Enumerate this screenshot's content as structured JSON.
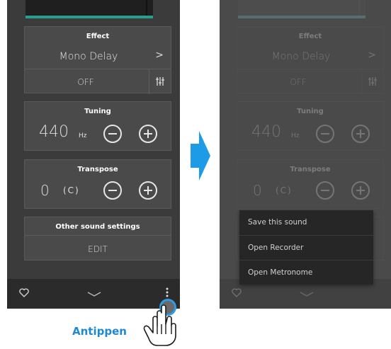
{
  "left_screen": {
    "effect": {
      "title": "Effect",
      "value": "Mono Delay",
      "chevron": ">",
      "state": "OFF"
    },
    "tuning": {
      "title": "Tuning",
      "value": "440",
      "unit": "Hz"
    },
    "transpose": {
      "title": "Transpose",
      "value": "0",
      "key": "(C)"
    },
    "other": {
      "title": "Other sound settings",
      "action": "EDIT"
    },
    "bottombar": {
      "icons": [
        "heart-icon",
        "chevron-down-icon",
        "more-vertical-icon"
      ]
    }
  },
  "right_screen": {
    "effect": {
      "title": "Effect",
      "value": "Mono Delay",
      "chevron": ">",
      "state": "OFF"
    },
    "tuning": {
      "title": "Tuning",
      "value": "440",
      "unit": "Hz"
    },
    "transpose": {
      "title": "Transpose",
      "value": "0",
      "key": "(C)"
    },
    "menu": {
      "items": [
        "Save this sound",
        "Open Recorder",
        "Open Metronome"
      ]
    }
  },
  "instruction": {
    "label": "Antippen"
  },
  "colors": {
    "accent_teal": "#2a9d8f",
    "tap_blue": "#2f9be0",
    "arrow_blue": "#1e9be6"
  }
}
